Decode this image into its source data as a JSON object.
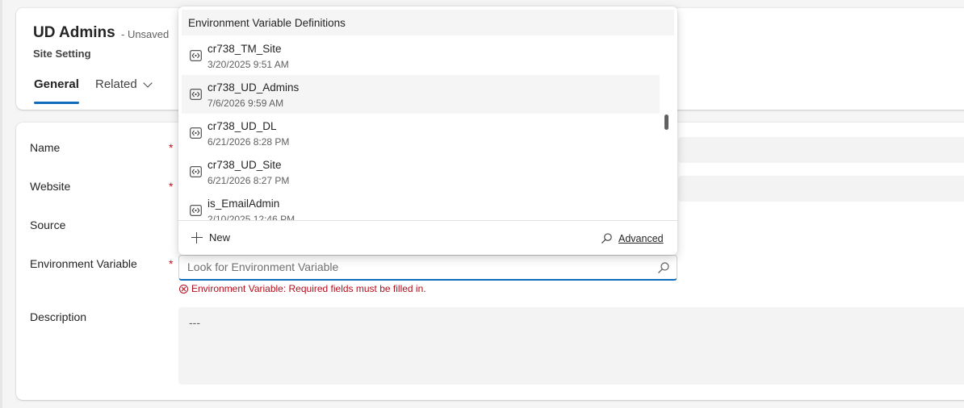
{
  "header": {
    "record_title": "UD Admins",
    "save_status": "- Unsaved",
    "entity_name": "Site Setting",
    "tabs": [
      {
        "label": "General"
      },
      {
        "label": "Related"
      }
    ]
  },
  "form": {
    "fields": [
      {
        "label": "Name",
        "required_marker": "*"
      },
      {
        "label": "Website",
        "required_marker": "*"
      },
      {
        "label": "Source"
      },
      {
        "label": "Environment Variable",
        "required_marker": "*",
        "placeholder": "Look for Environment Variable",
        "value": ""
      },
      {
        "label": "Description",
        "value": "---"
      }
    ],
    "error_message": "Environment Variable: Required fields must be filled in."
  },
  "lookup_flyout": {
    "header": "Environment Variable Definitions",
    "items": [
      {
        "name": "cr738_TM_Site",
        "date": "3/20/2025 9:51 AM"
      },
      {
        "name": "cr738_UD_Admins",
        "date": "7/6/2026 9:59 AM"
      },
      {
        "name": "cr738_UD_DL",
        "date": "6/21/2026 8:28 PM"
      },
      {
        "name": "cr738_UD_Site",
        "date": "6/21/2026 8:27 PM"
      },
      {
        "name": "is_EmailAdmin",
        "date": "2/10/2025 12:46 PM"
      }
    ],
    "new_label": "New",
    "advanced_label": "Advanced"
  },
  "colors": {
    "accent": "#0f6cbd",
    "error": "#c50f1f",
    "field_bg": "#f3f3f3",
    "page_bg": "#f5f5f5"
  },
  "icons": {
    "list_item": "environment-variable-icon",
    "search": "search-icon",
    "new": "plus-icon",
    "advanced": "search-icon",
    "tab_related": "chevron-down-icon",
    "error": "error-circle-icon"
  }
}
